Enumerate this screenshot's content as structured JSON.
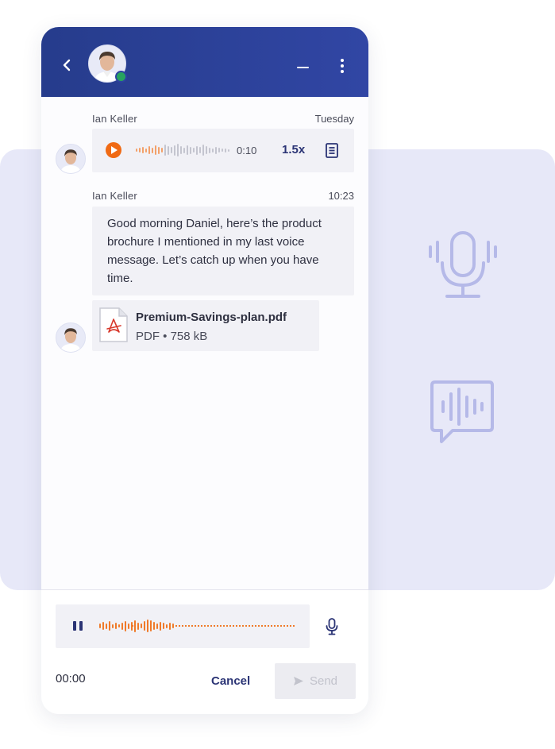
{
  "colors": {
    "header": "#2d43a0",
    "accent": "#f06a14",
    "online": "#27a35f",
    "panel": "#e7e8f8",
    "text_primary": "#2e3040",
    "button_text": "#2b3475"
  },
  "header": {
    "back_icon": "chevron-left-icon",
    "status": "online",
    "actions": [
      "minimize-icon",
      "more-vertical-icon"
    ]
  },
  "messages": [
    {
      "sender": "Ian Keller",
      "time": "Tuesday",
      "type": "voice",
      "duration": "0:10",
      "speed": "1.5x",
      "played_fraction": 0.3
    },
    {
      "sender": "Ian Keller",
      "time": "10:23",
      "type": "text",
      "text": "Good morning Daniel, here’s the product brochure I mentioned in my last voice message. Let’s catch up when you have time."
    },
    {
      "type": "file",
      "file_name": "Premium-Savings-plan.pdf",
      "file_meta": "PDF • 758 kB",
      "icon": "pdf-file-icon"
    }
  ],
  "composer": {
    "elapsed": "00:00",
    "cancel_label": "Cancel",
    "send_label": "Send",
    "recording_state": "recording"
  },
  "decor": [
    "microphone-icon",
    "voice-message-icon"
  ]
}
